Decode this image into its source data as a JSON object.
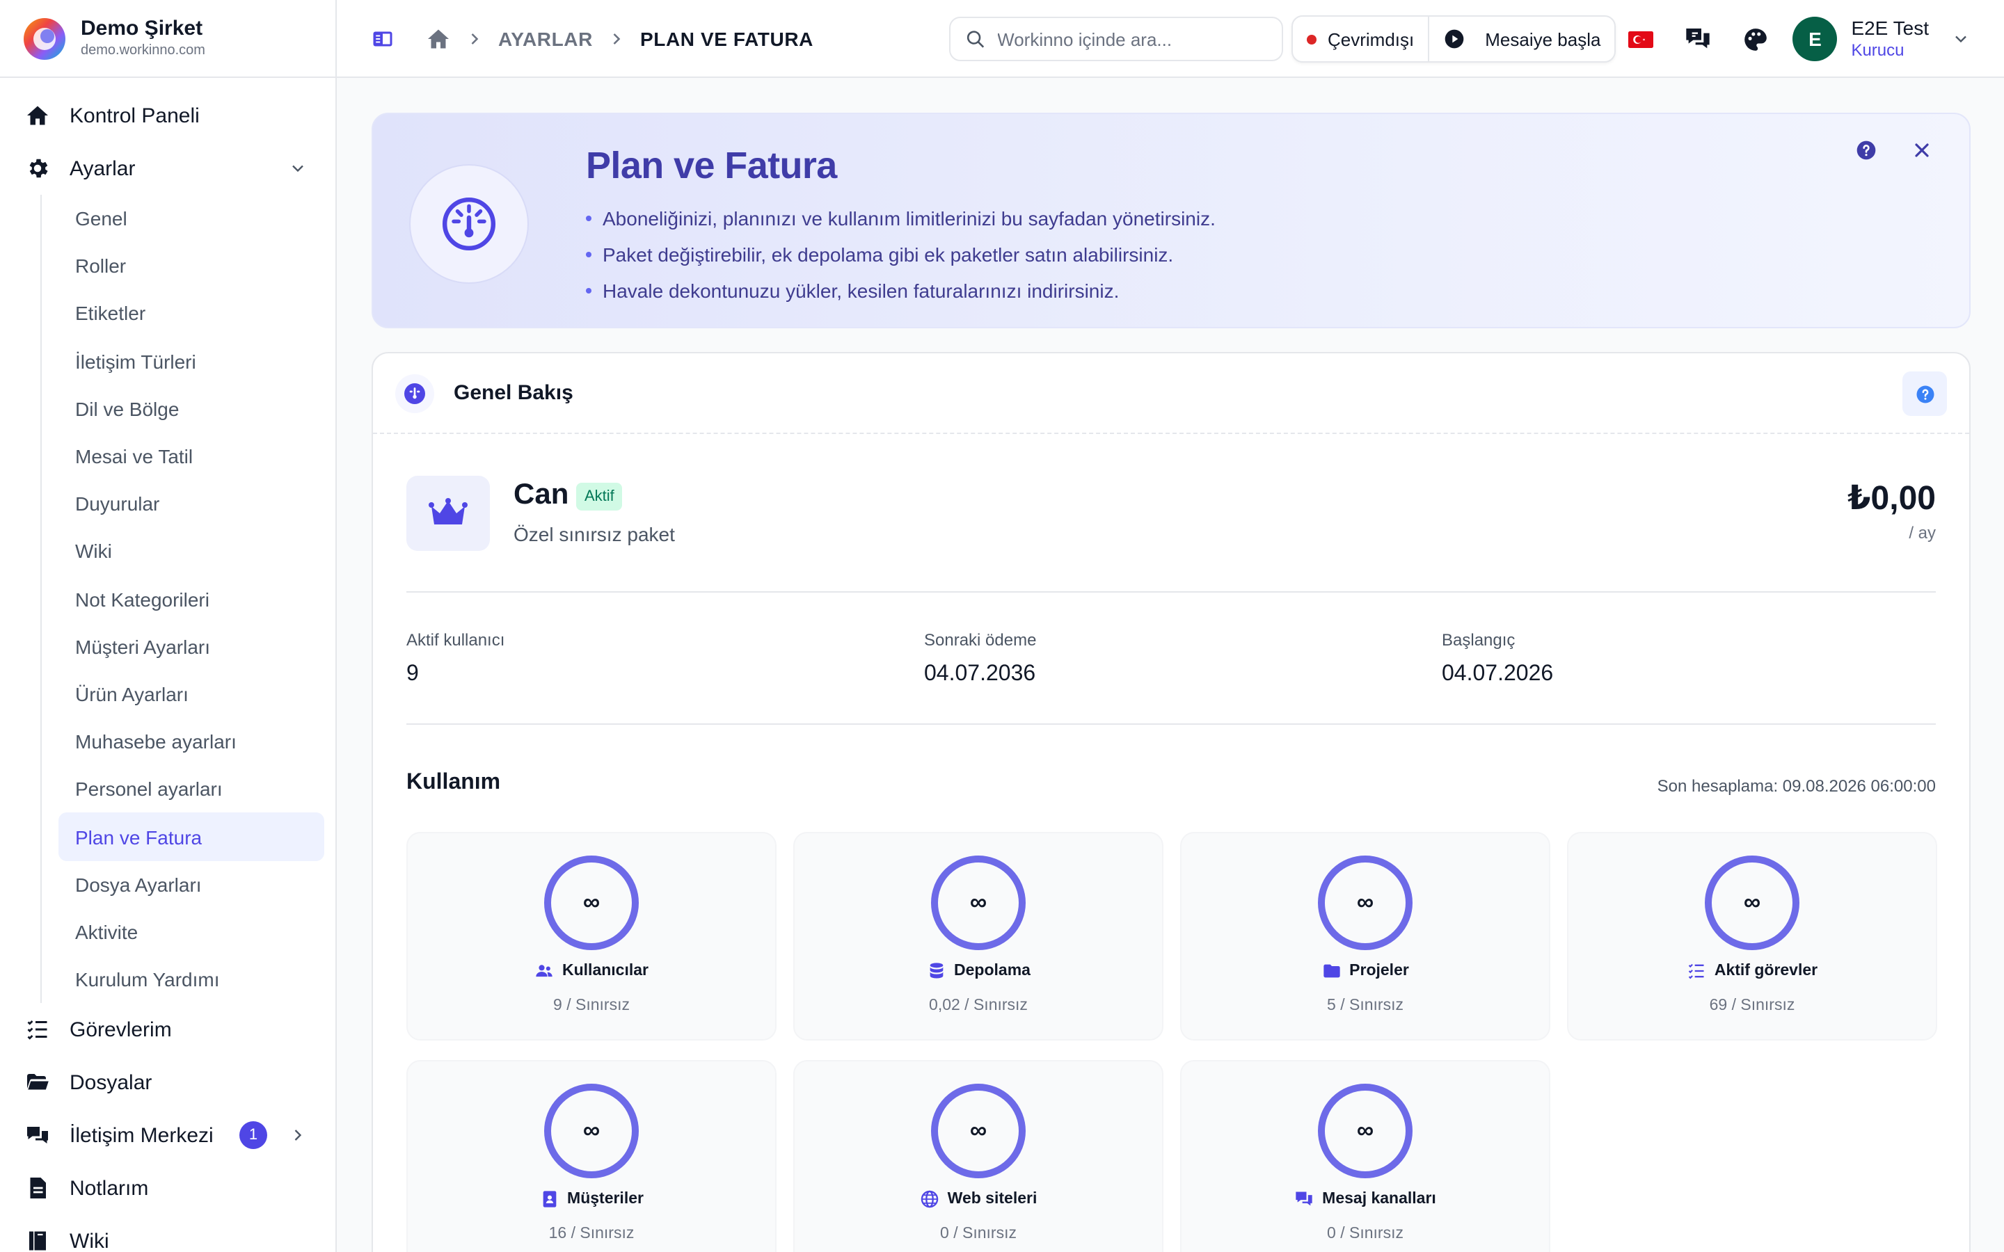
{
  "brand": {
    "name": "Demo Şirket",
    "domain": "demo.workinno.com"
  },
  "sidebar": {
    "top_items": [
      {
        "label": "Kontrol Paneli",
        "icon": "home-icon"
      },
      {
        "label": "Ayarlar",
        "icon": "gear-icon"
      }
    ],
    "settings_items": [
      {
        "label": "Genel"
      },
      {
        "label": "Roller"
      },
      {
        "label": "Etiketler"
      },
      {
        "label": "İletişim Türleri"
      },
      {
        "label": "Dil ve Bölge"
      },
      {
        "label": "Mesai ve Tatil"
      },
      {
        "label": "Duyurular"
      },
      {
        "label": "Wiki"
      },
      {
        "label": "Not Kategorileri"
      },
      {
        "label": "Müşteri Ayarları"
      },
      {
        "label": "Ürün Ayarları"
      },
      {
        "label": "Muhasebe ayarları"
      },
      {
        "label": "Personel ayarları"
      },
      {
        "label": "Plan ve Fatura",
        "active": true
      },
      {
        "label": "Dosya Ayarları"
      },
      {
        "label": "Aktivite"
      },
      {
        "label": "Kurulum Yardımı"
      }
    ],
    "bottom_items": [
      {
        "label": "Görevlerim",
        "icon": "tasks-icon"
      },
      {
        "label": "Dosyalar",
        "icon": "folder-icon"
      },
      {
        "label": "İletişim Merkezi",
        "icon": "chat-icon",
        "badge": "1"
      },
      {
        "label": "Notlarım",
        "icon": "note-icon"
      },
      {
        "label": "Wiki",
        "icon": "book-icon"
      }
    ]
  },
  "topbar": {
    "breadcrumb": {
      "parent": "AYARLAR",
      "current": "PLAN VE FATURA"
    },
    "search_placeholder": "Workinno içinde ara...",
    "status_label": "Çevrimdışı",
    "shift_label": "Mesaiye başla",
    "user": {
      "initial": "E",
      "name": "E2E Test",
      "role": "Kurucu"
    }
  },
  "hero": {
    "title": "Plan ve Fatura",
    "bullets": [
      "Aboneliğinizi, planınızı ve kullanım limitlerinizi bu sayfadan yönetirsiniz.",
      "Paket değiştirebilir, ek depolama gibi ek paketler satın alabilirsiniz.",
      "Havale dekontunuzu yükler, kesilen faturalarınızı indirirsiniz."
    ]
  },
  "overview": {
    "title": "Genel Bakış",
    "plan": {
      "name": "Can",
      "status": "Aktif",
      "description": "Özel sınırsız paket",
      "price": "₺0,00",
      "period": "/ ay"
    },
    "stats": [
      {
        "label": "Aktif kullanıcı",
        "value": "9"
      },
      {
        "label": "Sonraki ödeme",
        "value": "04.07.2036"
      },
      {
        "label": "Başlangıç",
        "value": "04.07.2026"
      }
    ],
    "usage_title": "Kullanım",
    "last_calculated": "Son hesaplama: 09.08.2026 06:00:00",
    "usage": [
      {
        "label": "Kullanıcılar",
        "icon": "users-icon",
        "value": "9 / Sınırsız",
        "ring": "∞"
      },
      {
        "label": "Depolama",
        "icon": "database-icon",
        "value": "0,02 / Sınırsız",
        "ring": "∞"
      },
      {
        "label": "Projeler",
        "icon": "folder-icon",
        "value": "5 / Sınırsız",
        "ring": "∞"
      },
      {
        "label": "Aktif görevler",
        "icon": "list-check-icon",
        "value": "69 / Sınırsız",
        "ring": "∞"
      },
      {
        "label": "Müşteriler",
        "icon": "contact-book-icon",
        "value": "16 / Sınırsız",
        "ring": "∞"
      },
      {
        "label": "Web siteleri",
        "icon": "globe-icon",
        "value": "0 / Sınırsız",
        "ring": "∞"
      },
      {
        "label": "Mesaj kanalları",
        "icon": "chat-icon",
        "value": "0 / Sınırsız",
        "ring": "∞"
      }
    ]
  },
  "colors": {
    "accent": "#4f46e5",
    "ring": "#6d6ae8",
    "active_badge_bg": "#d1fae5",
    "active_badge_text": "#047857"
  }
}
